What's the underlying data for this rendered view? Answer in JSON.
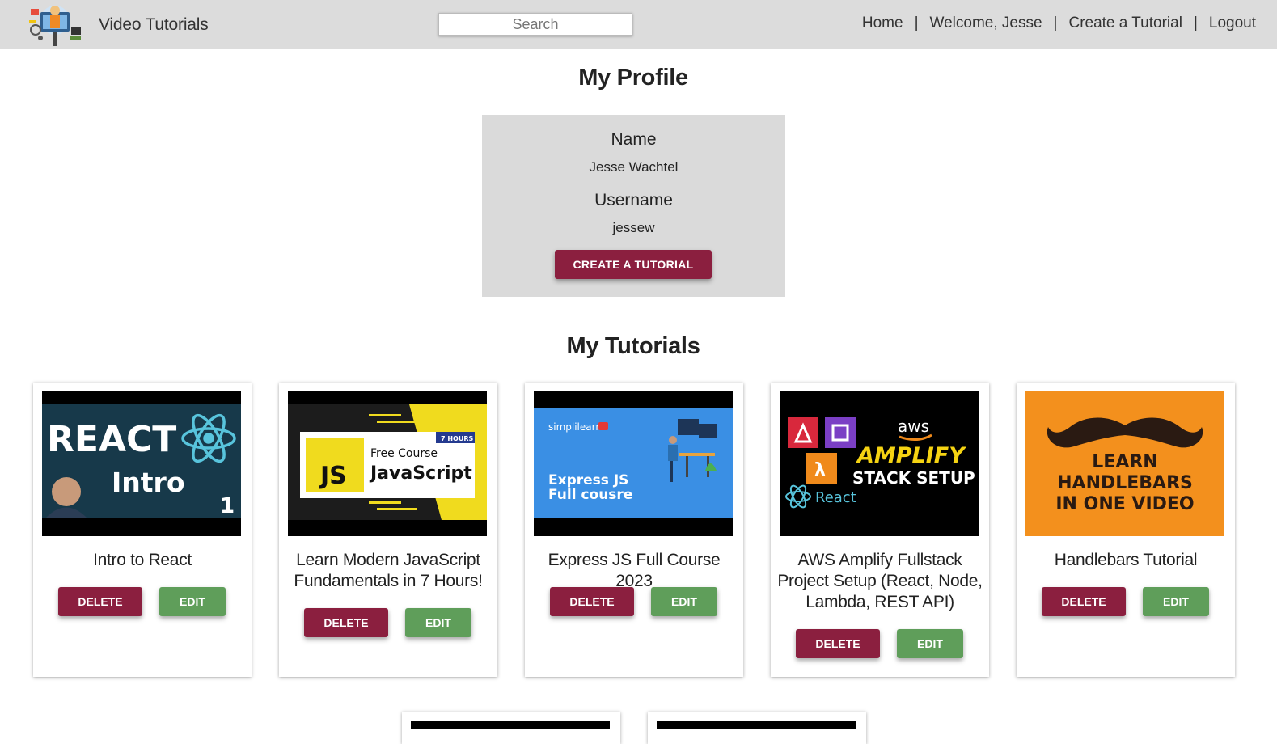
{
  "navbar": {
    "brand_title": "Video Tutorials",
    "search_placeholder": "Search",
    "links": [
      "Home",
      "Welcome, Jesse",
      "Create a Tutorial",
      "Logout"
    ],
    "separator": "|"
  },
  "profile": {
    "title": "My Profile",
    "name_label": "Name",
    "name_value": "Jesse Wachtel",
    "username_label": "Username",
    "username_value": "jessew",
    "create_button": "CREATE A TUTORIAL"
  },
  "tutorials": {
    "title": "My Tutorials",
    "delete_label": "DELETE",
    "edit_label": "EDIT",
    "items": [
      {
        "title": "Intro to React",
        "thumb_text": [
          "REACT",
          "Intro",
          "1"
        ]
      },
      {
        "title": "Learn Modern JavaScript Fundamentals in 7 Hours!",
        "thumb_text": [
          "7 HOURS",
          "Free Course",
          "JavaScript",
          "JS"
        ]
      },
      {
        "title": "Express JS Full Course 2023",
        "thumb_text": [
          "simplilearn",
          "Express JS",
          "Full cousre"
        ]
      },
      {
        "title": "AWS Amplify Fullstack Project Setup (React, Node, Lambda, REST API)",
        "thumb_text": [
          "aws",
          "AMPLIFY",
          "STACK SETUP",
          "React"
        ]
      },
      {
        "title": "Handlebars Tutorial",
        "thumb_text": [
          "LEARN",
          "HANDLEBARS",
          "IN ONE VIDEO"
        ]
      }
    ]
  },
  "colors": {
    "navbar_bg": "#dcdcdc",
    "profile_bg": "#dadada",
    "primary_button": "#8b1f3f",
    "edit_button": "#5f9e5a"
  }
}
